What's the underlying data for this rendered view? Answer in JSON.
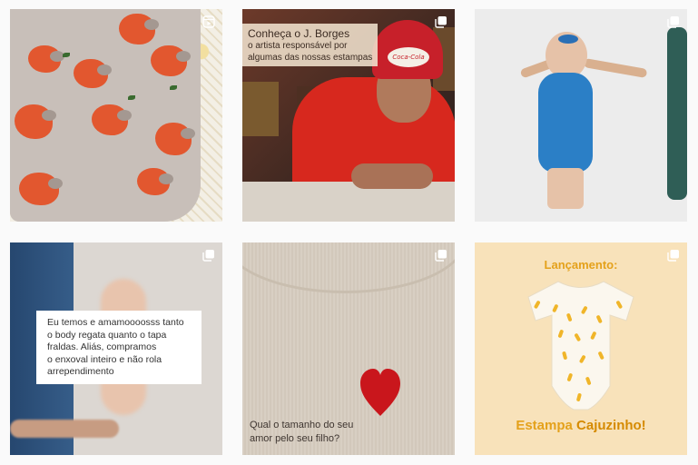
{
  "grid": {
    "tiles": [
      {
        "type": "reel",
        "badge_icon": "reels-icon"
      },
      {
        "type": "carousel",
        "badge_icon": "carousel-icon",
        "caption_title": "Conheça o J. Borges",
        "caption_lines": [
          "o artista responsável por",
          "algumas das nossas estampas"
        ],
        "cap_text": "Coca-Cola"
      },
      {
        "type": "carousel",
        "badge_icon": "carousel-icon"
      },
      {
        "type": "carousel",
        "badge_icon": "carousel-icon",
        "text_lines": [
          "Eu temos e amamoooosss tanto",
          "o body regata quanto o tapa",
          "fraldas. Aliás, compramos",
          "o enxoval inteiro e não rola",
          "arrependimento"
        ]
      },
      {
        "type": "carousel",
        "badge_icon": "carousel-icon",
        "question_lines": [
          "Qual o tamanho do seu",
          "amor pelo seu filho?"
        ]
      },
      {
        "type": "carousel",
        "badge_icon": "carousel-icon",
        "headline": "Lançamento:",
        "footer_prefix": "Estampa ",
        "footer_bold": "Cajuzinho!"
      }
    ]
  },
  "colors": {
    "page_bg": "#fafafa",
    "cashew_red": "#e2572f",
    "launch_yellow": "#e4a11b",
    "heart_red": "#c9161c"
  }
}
